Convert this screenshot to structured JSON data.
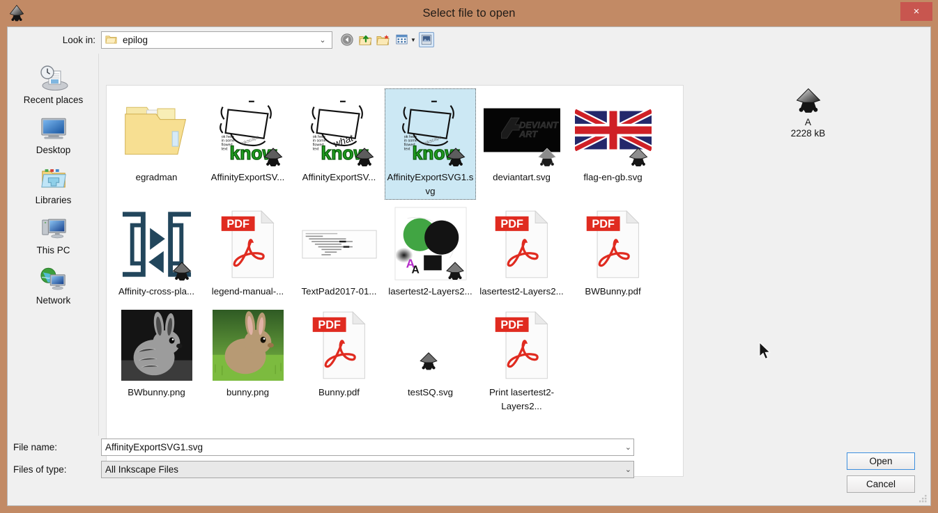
{
  "window": {
    "title": "Select file to open",
    "app_icon": "inkscape-icon",
    "close_label": "×",
    "titlebar_color": "#c28a65",
    "close_button_color": "#c8564f",
    "accent_selection_color": "#cce8f4",
    "focus_border_color": "#3c8edd"
  },
  "toolbar": {
    "lookin_label": "Look in:",
    "lookin_value": "epilog",
    "lookin_chevron": "⌄",
    "buttons": [
      {
        "name": "back-button",
        "icon": "back-arrow-icon"
      },
      {
        "name": "up-one-level-button",
        "icon": "up-folder-icon"
      },
      {
        "name": "create-new-folder-button",
        "icon": "new-folder-icon"
      },
      {
        "name": "view-menu-button",
        "icon": "view-list-icon"
      },
      {
        "name": "preview-pane-button",
        "icon": "preview-pane-icon",
        "active": true
      }
    ]
  },
  "sidebar": {
    "items": [
      {
        "label": "Recent places",
        "icon": "recent-places-icon"
      },
      {
        "label": "Desktop",
        "icon": "desktop-icon"
      },
      {
        "label": "Libraries",
        "icon": "libraries-icon"
      },
      {
        "label": "This PC",
        "icon": "this-pc-icon"
      },
      {
        "label": "Network",
        "icon": "network-icon"
      }
    ]
  },
  "files": [
    {
      "name": "egradman",
      "kind": "folder",
      "selected": false
    },
    {
      "name": "AffinityExportSV...",
      "kind": "know-thumb",
      "variant": "plain",
      "selected": false
    },
    {
      "name": "AffinityExportSV...",
      "kind": "know-thumb",
      "variant": "what",
      "selected": false
    },
    {
      "name": "AffinityExportSVG1.svg",
      "kind": "know-thumb",
      "variant": "plain",
      "selected": true
    },
    {
      "name": "deviantart.svg",
      "kind": "deviantart-thumb",
      "selected": false
    },
    {
      "name": "flag-en-gb.svg",
      "kind": "union-jack-thumb",
      "selected": false
    },
    {
      "name": "Affinity-cross-pla...",
      "kind": "affinity-cross-thumb",
      "selected": false
    },
    {
      "name": "legend-manual-...",
      "kind": "pdf",
      "selected": false
    },
    {
      "name": "TextPad2017-01...",
      "kind": "text-doc-thumb",
      "selected": false
    },
    {
      "name": "lasertest2-Layers2...",
      "kind": "lasertest-thumb",
      "selected": false
    },
    {
      "name": "lasertest2-Layers2...",
      "kind": "pdf",
      "selected": false
    },
    {
      "name": "BWBunny.pdf",
      "kind": "pdf",
      "selected": false
    },
    {
      "name": "BWbunny.png",
      "kind": "bunny-bw-thumb",
      "selected": false
    },
    {
      "name": "bunny.png",
      "kind": "bunny-color-thumb",
      "selected": false
    },
    {
      "name": "Bunny.pdf",
      "kind": "pdf",
      "selected": false
    },
    {
      "name": "testSQ.svg",
      "kind": "inkscape-generic",
      "selected": false
    },
    {
      "name": "Print lasertest2-Layers2...",
      "kind": "pdf",
      "selected": false
    }
  ],
  "preview": {
    "icon": "inkscape-icon",
    "name": "A",
    "size": "2228 kB"
  },
  "form": {
    "filename_label": "File name:",
    "filename_value": "AffinityExportSVG1.svg",
    "filename_placeholder": "File name",
    "filetype_label": "Files of type:",
    "filetype_value": "All Inkscape Files",
    "chevron": "⌄"
  },
  "actions": {
    "open_label": "Open",
    "cancel_label": "Cancel"
  }
}
